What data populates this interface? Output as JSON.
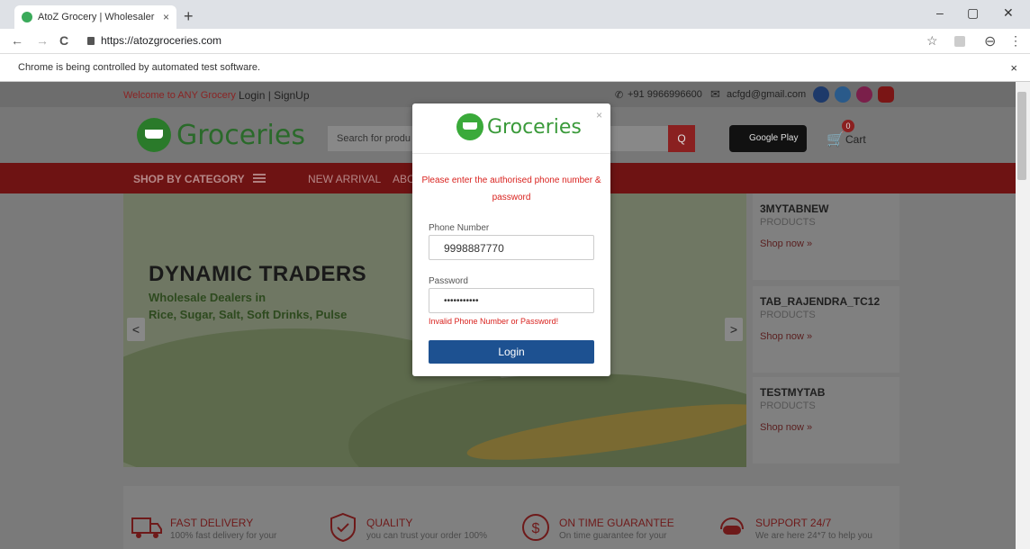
{
  "browser": {
    "tab_title": "AtoZ Grocery | Wholesaler in Ban",
    "tab_close": "×",
    "new_tab": "+",
    "url": "https://atozgroceries.com",
    "back": "←",
    "forward": "→",
    "reload": "C",
    "star": "☆",
    "menu": "⋮",
    "profile": "⊖",
    "minimize": "–",
    "maximize": "▢",
    "close": "✕",
    "infobar_text": "Chrome is being controlled by automated test software.",
    "infobar_close": "×"
  },
  "topbar": {
    "welcome": "Welcome to ANY Grocery",
    "login_signup": "Login | SignUp",
    "phone": "+91 9966996600",
    "email": "acfgd@gmail.com"
  },
  "header": {
    "logo_text": "Groceries",
    "search_placeholder": "Search for produ",
    "search_icon": "Q",
    "google_play": "Google Play",
    "cart_label": "Cart",
    "cart_count": "0"
  },
  "menu": {
    "shop_by_category": "SHOP BY CATEGORY",
    "new_arrival": "NEW ARRIVAL",
    "about": "ABC"
  },
  "banner": {
    "title": "DYNAMIC TRADERS",
    "line1": "Wholesale Dealers in",
    "line2": "Rice, Sugar, Salt, Soft Drinks, Pulse",
    "prev": "<",
    "next": ">"
  },
  "side_products": [
    {
      "title": "3MYTABNEW",
      "sub": "PRODUCTS",
      "cta": "Shop now »"
    },
    {
      "title": "TAB_RAJENDRA_TC12",
      "sub": "PRODUCTS",
      "cta": "Shop now »"
    },
    {
      "title": "TESTMYTAB",
      "sub": "PRODUCTS",
      "cta": "Shop now »"
    }
  ],
  "features": [
    {
      "title": "FAST DELIVERY",
      "desc": "100% fast delivery for your"
    },
    {
      "title": "QUALITY",
      "desc": "you can trust your order 100%"
    },
    {
      "title": "ON TIME GUARANTEE",
      "desc": "On time guarantee for your"
    },
    {
      "title": "SUPPORT 24/7",
      "desc": "We are here 24*7 to help you"
    }
  ],
  "login_modal": {
    "logo_text": "Groceries",
    "close": "×",
    "message": "Please enter the authorised phone number & password",
    "phone_label": "Phone Number",
    "phone_value": "9998887770",
    "password_label": "Password",
    "password_value": "•••••••••••",
    "error": "Invalid Phone Number or Password!",
    "login_button": "Login"
  },
  "colors": {
    "accent_red": "#d9231f",
    "login_blue": "#1d5191",
    "menu_maroon": "#6e1313",
    "brand_green": "#3aaa3a"
  }
}
